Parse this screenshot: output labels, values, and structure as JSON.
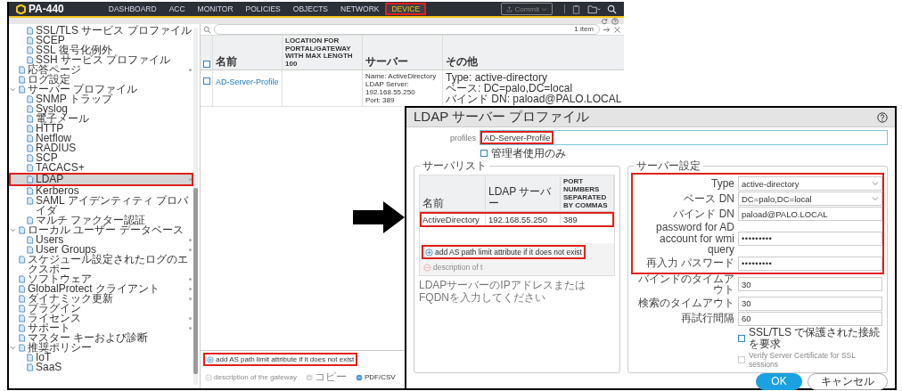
{
  "main": {
    "logo": "PA-440",
    "tabs": [
      {
        "label": "DASHBOARD",
        "selected": false,
        "highlighted": false
      },
      {
        "label": "ACC",
        "selected": false,
        "highlighted": false
      },
      {
        "label": "MONITOR",
        "selected": false,
        "highlighted": false
      },
      {
        "label": "POLICIES",
        "selected": false,
        "highlighted": false
      },
      {
        "label": "OBJECTS",
        "selected": false,
        "highlighted": false
      },
      {
        "label": "NETWORK",
        "selected": false,
        "highlighted": false
      },
      {
        "label": "DEVICE",
        "selected": true,
        "highlighted": true
      }
    ],
    "commit": {
      "label": "Commit",
      "disabled": true
    },
    "tree": [
      {
        "children": [
          {
            "label": "SSL/TLS サービス プロファイル",
            "selected": false,
            "dot": false,
            "highlighted": false
          },
          {
            "label": "SCEP",
            "selected": false,
            "dot": false,
            "highlighted": false
          },
          {
            "label": "SSL 復号化例外",
            "selected": false,
            "dot": false,
            "highlighted": false
          },
          {
            "label": "SSH サービス プロファイル",
            "selected": false,
            "dot": false,
            "highlighted": false
          }
        ]
      },
      {
        "label": "応答ページ",
        "selected": false,
        "dot": true,
        "highlighted": false
      },
      {
        "label": "ログ設定",
        "selected": false,
        "dot": false,
        "highlighted": false
      },
      {
        "label": "サーバー プロファイル",
        "selected": false,
        "dot": false,
        "highlighted": false,
        "expanded": true,
        "children": [
          {
            "label": "SNMP トラップ",
            "selected": false,
            "dot": false,
            "highlighted": false
          },
          {
            "label": "Syslog",
            "selected": false,
            "dot": false,
            "highlighted": false
          },
          {
            "label": "電子メール",
            "selected": false,
            "dot": false,
            "highlighted": false
          },
          {
            "label": "HTTP",
            "selected": false,
            "dot": false,
            "highlighted": false
          },
          {
            "label": "Netflow",
            "selected": false,
            "dot": false,
            "highlighted": false
          },
          {
            "label": "RADIUS",
            "selected": false,
            "dot": false,
            "highlighted": false
          },
          {
            "label": "SCP",
            "selected": false,
            "dot": false,
            "highlighted": false
          },
          {
            "label": "TACACS+",
            "selected": false,
            "dot": false,
            "highlighted": false
          },
          {
            "label": "LDAP",
            "selected": true,
            "dot": true,
            "highlighted": true
          },
          {
            "label": "Kerberos",
            "selected": false,
            "dot": false,
            "highlighted": false
          },
          {
            "label": "SAML アイデンティティ プロバイダ",
            "selected": false,
            "dot": false,
            "highlighted": false
          },
          {
            "label": "マルチ ファクター認証",
            "selected": false,
            "dot": false,
            "highlighted": false
          }
        ]
      },
      {
        "label": "ローカル ユーザー データベース",
        "selected": false,
        "dot": false,
        "highlighted": false,
        "expanded": true,
        "children": [
          {
            "label": "Users",
            "selected": false,
            "dot": true,
            "highlighted": false
          },
          {
            "label": "User Groups",
            "selected": false,
            "dot": true,
            "highlighted": false
          }
        ]
      },
      {
        "label": "スケジュール設定されたログのエクスポー",
        "selected": false,
        "dot": false,
        "highlighted": false
      },
      {
        "label": "ソフトウェア",
        "selected": false,
        "dot": true,
        "highlighted": false
      },
      {
        "label": "GlobalProtect クライアント",
        "selected": false,
        "dot": true,
        "highlighted": false
      },
      {
        "label": "ダイナミック更新",
        "selected": false,
        "dot": true,
        "highlighted": false
      },
      {
        "label": "プラグイン",
        "selected": false,
        "dot": false,
        "highlighted": false
      },
      {
        "label": "ライセンス",
        "selected": false,
        "dot": true,
        "highlighted": false
      },
      {
        "label": "サポート",
        "selected": false,
        "dot": true,
        "highlighted": false
      },
      {
        "label": "マスター キーおよび診断",
        "selected": false,
        "dot": false,
        "highlighted": false
      },
      {
        "label": "推奨ポリシー",
        "selected": false,
        "dot": false,
        "highlighted": false,
        "expanded": true,
        "children": [
          {
            "label": "IoT",
            "selected": false,
            "dot": false,
            "highlighted": false
          },
          {
            "label": "SaaS",
            "selected": false,
            "dot": false,
            "highlighted": false
          }
        ]
      }
    ],
    "search": {
      "count": "1 item"
    },
    "table": {
      "all_checked": false,
      "columns": [
        "名前",
        "LOCATION FOR PORTAL/GATEWAY WITH MAX LENGTH 100",
        "サーバー",
        "その他"
      ],
      "rows": [
        {
          "checked": false,
          "name": "AD-Server-Profile",
          "server": [
            "Name: ActiveDirectory LDAP Server: 192.168.55.250",
            "Port: 389"
          ],
          "other": [
            "Type: active-directory",
            "ベース: DC=palo,DC=local",
            "バインド DN: paload@PALO.LOCAL"
          ]
        }
      ]
    },
    "actions": [
      {
        "label": "add AS path limit attribute if it does not exist",
        "kind": "add",
        "disabled": false,
        "highlighted": true
      },
      {
        "label": "description of the gateway",
        "kind": "delete",
        "disabled": true,
        "highlighted": false
      },
      {
        "label": "コピー",
        "kind": "copy",
        "disabled": true,
        "highlighted": false
      },
      {
        "label": "PDF/CSV",
        "kind": "export",
        "disabled": false,
        "highlighted": false
      }
    ]
  },
  "dialog": {
    "title": "LDAP サーバー プロファイル",
    "profile": {
      "label": "profiles",
      "value": "AD-Server-Profile",
      "highlighted": true
    },
    "admin_only": {
      "label": "管理者使用のみ",
      "checked": false
    },
    "server_list": {
      "legend": "サーバリスト",
      "columns": [
        "名前",
        "LDAP サーバー",
        "PORT NUMBERS SEPARATED BY COMMAS"
      ],
      "rows": [
        {
          "cells": [
            "ActiveDirectory",
            "192.168.55.250",
            "389"
          ],
          "highlighted": true
        }
      ],
      "actions": [
        {
          "label": "add AS path limit attribute if it does not exist",
          "kind": "add",
          "disabled": false,
          "highlighted": true
        },
        {
          "label": "description of t",
          "kind": "delete",
          "disabled": true,
          "highlighted": false
        }
      ],
      "hint": "LDAPサーバーのIPアドレスまたはFQDNを入力してください"
    },
    "settings": {
      "legend": "サーバー設定",
      "fields": [
        {
          "label": "Type",
          "kind": "select",
          "value": "active-directory",
          "highlighted": true
        },
        {
          "label": "ベース DN",
          "kind": "select",
          "value": "DC=palo,DC=local",
          "highlighted": true
        },
        {
          "label": "バインド DN",
          "kind": "text",
          "value": "paload@PALO.LOCAL",
          "highlighted": true
        },
        {
          "label": "password for AD account for wmi query",
          "kind": "password",
          "value": "•••••••••",
          "highlighted": true
        },
        {
          "label": "再入力 パスワード",
          "kind": "password",
          "value": "•••••••••",
          "highlighted": true
        },
        {
          "label": "バインドのタイムアウト",
          "kind": "text",
          "value": "30",
          "highlighted": false
        },
        {
          "label": "検索のタイムアウト",
          "kind": "text",
          "value": "30",
          "highlighted": false
        },
        {
          "label": "再試行間隔",
          "kind": "text",
          "value": "60",
          "highlighted": false
        },
        {
          "label": "SSL/TLS で保護された接続を要求",
          "kind": "checkbox",
          "checked": false,
          "disabled": false,
          "highlighted": false
        },
        {
          "label": "Verify Server Certificate for SSL sessions",
          "kind": "checkbox",
          "checked": false,
          "disabled": true,
          "highlighted": false
        }
      ]
    },
    "buttons": [
      {
        "label": "OK",
        "kind": "primary"
      },
      {
        "label": "キャンセル",
        "kind": "secondary"
      }
    ]
  }
}
